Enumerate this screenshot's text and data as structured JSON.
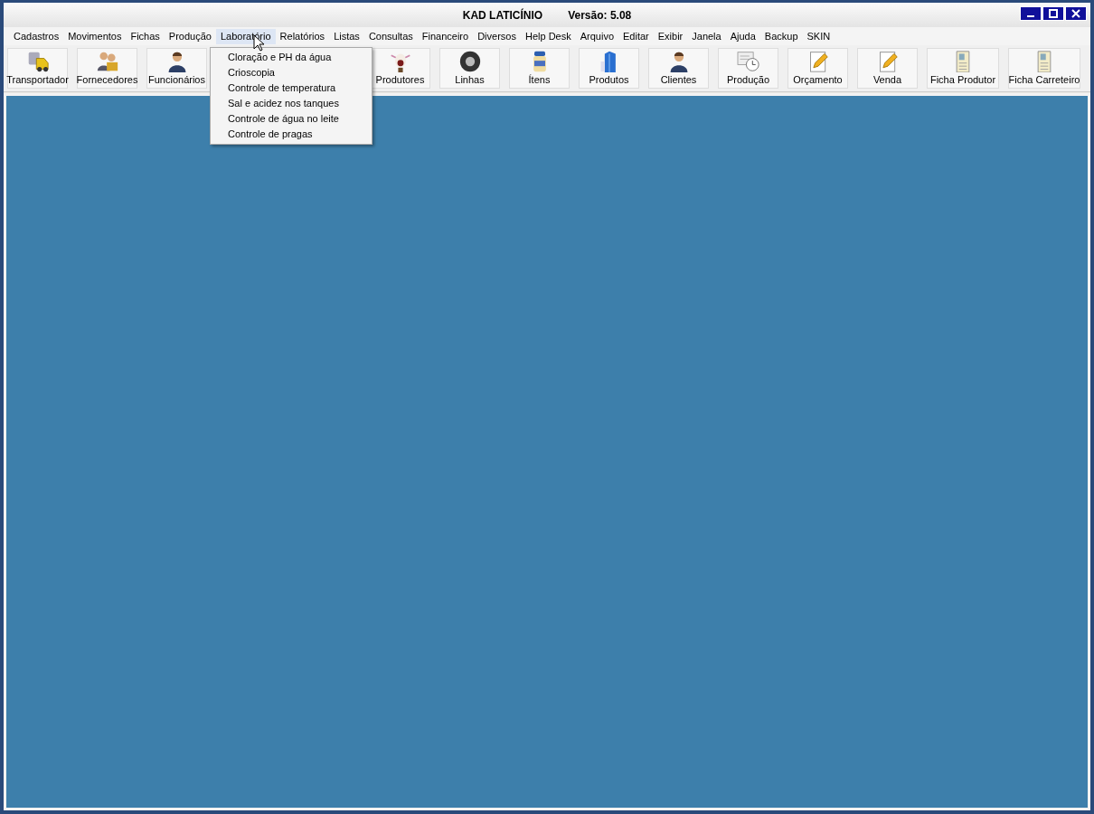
{
  "window": {
    "title": "KAD LATICÍNIO",
    "version": "Versão: 5.08"
  },
  "menu_bar": [
    {
      "label": "Cadastros",
      "selected": false
    },
    {
      "label": "Movimentos",
      "selected": false
    },
    {
      "label": "Fichas",
      "selected": false
    },
    {
      "label": "Produção",
      "selected": false
    },
    {
      "label": "Laboratório",
      "selected": true
    },
    {
      "label": "Relatórios",
      "selected": false
    },
    {
      "label": "Listas",
      "selected": false
    },
    {
      "label": "Consultas",
      "selected": false
    },
    {
      "label": "Financeiro",
      "selected": false
    },
    {
      "label": "Diversos",
      "selected": false
    },
    {
      "label": "Help Desk",
      "selected": false
    },
    {
      "label": "Arquivo",
      "selected": false
    },
    {
      "label": "Editar",
      "selected": false
    },
    {
      "label": "Exibir",
      "selected": false
    },
    {
      "label": "Janela",
      "selected": false
    },
    {
      "label": "Ajuda",
      "selected": false
    },
    {
      "label": "Backup",
      "selected": false
    },
    {
      "label": "SKIN",
      "selected": false
    }
  ],
  "dropdown": [
    "Cloração e PH da água",
    "Crioscopia",
    "Controle de temperatura",
    "Sal e acidez nos tanques",
    "Controle de água no leite",
    "Controle de pragas"
  ],
  "toolbar": [
    {
      "label": "Transportador",
      "kind": "truck"
    },
    {
      "label": "Fornecedores",
      "kind": "people"
    },
    {
      "label": "Funcionários",
      "kind": "person"
    },
    {
      "label": "Produtores",
      "kind": "cow"
    },
    {
      "label": "Linhas",
      "kind": "tire"
    },
    {
      "label": "Ítens",
      "kind": "jar"
    },
    {
      "label": "Produtos",
      "kind": "carton"
    },
    {
      "label": "Clientes",
      "kind": "person"
    },
    {
      "label": "Produção",
      "kind": "clock"
    },
    {
      "label": "Orçamento",
      "kind": "pencil"
    },
    {
      "label": "Venda",
      "kind": "pencil"
    },
    {
      "label": "Ficha Produtor",
      "kind": "card"
    },
    {
      "label": "Ficha Carreteiro",
      "kind": "card"
    }
  ]
}
